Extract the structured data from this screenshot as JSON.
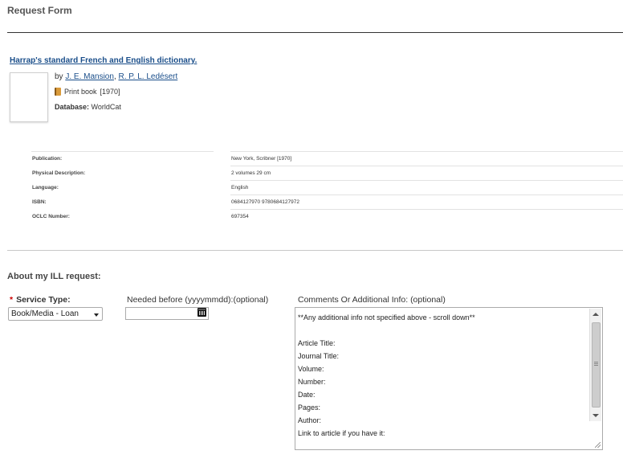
{
  "page": {
    "title": "Request Form"
  },
  "book": {
    "title": "Harrap's standard French and English dictionary.",
    "by_prefix": "by",
    "authors": [
      "J. E. Mansion",
      "R. P. L. Ledésert"
    ],
    "author_separator": ",",
    "format_label": "Print book",
    "year": "[1970]",
    "database_label": "Database:",
    "database_value": "WorldCat",
    "icon": "book-format-icon"
  },
  "details": [
    {
      "label": "Publication:",
      "value": "New York, Scribner [1970]"
    },
    {
      "label": "Physical Description:",
      "value": "2 volumes 29 cm"
    },
    {
      "label": "Language:",
      "value": "English"
    },
    {
      "label": "ISBN:",
      "value": "0684127970 9780684127972"
    },
    {
      "label": "OCLC Number:",
      "value": "697354"
    }
  ],
  "request": {
    "section_title": "About my ILL request:",
    "service_type": {
      "required_mark": "*",
      "label": "Service Type:",
      "selected": "Book/Media - Loan"
    },
    "needed_before": {
      "label": "Needed before (yyyymmdd):(optional)",
      "value": "",
      "icon": "calendar-icon"
    },
    "comments": {
      "label": "Comments Or Additional Info: (optional)",
      "value": "**Any additional info not specified above - scroll down**\n\nArticle Title:\nJournal Title:\nVolume:\nNumber:\nDate:\nPages:\nAuthor:\nLink to article if you have it:"
    }
  },
  "colors": {
    "link": "#1a4e8a",
    "required": "#cc0000",
    "text": "#333333"
  }
}
